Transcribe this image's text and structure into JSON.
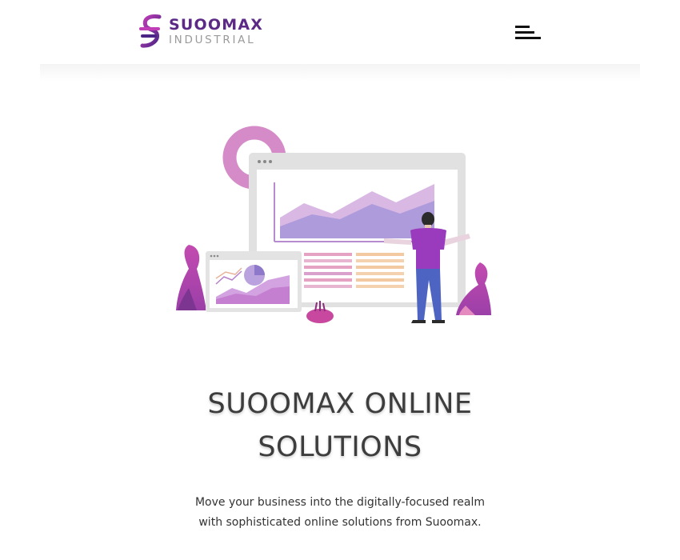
{
  "header": {
    "brand_name": "SUOOMAX",
    "brand_subtitle": "INDUSTRIAL",
    "menu_icon": "menu-icon"
  },
  "hero": {
    "title_line1": "SUOOMAX ONLINE",
    "title_line2": "SOLUTIONS",
    "description": "Move your business into the digitally-focused realm with sophisticated online solutions from Suoomax."
  },
  "colors": {
    "brand_purple": "#5c2a86",
    "accent_magenta": "#b23db0",
    "light_purple": "#b7a3dd",
    "pink": "#d58bc7",
    "text_dark": "#3d3d3d"
  }
}
